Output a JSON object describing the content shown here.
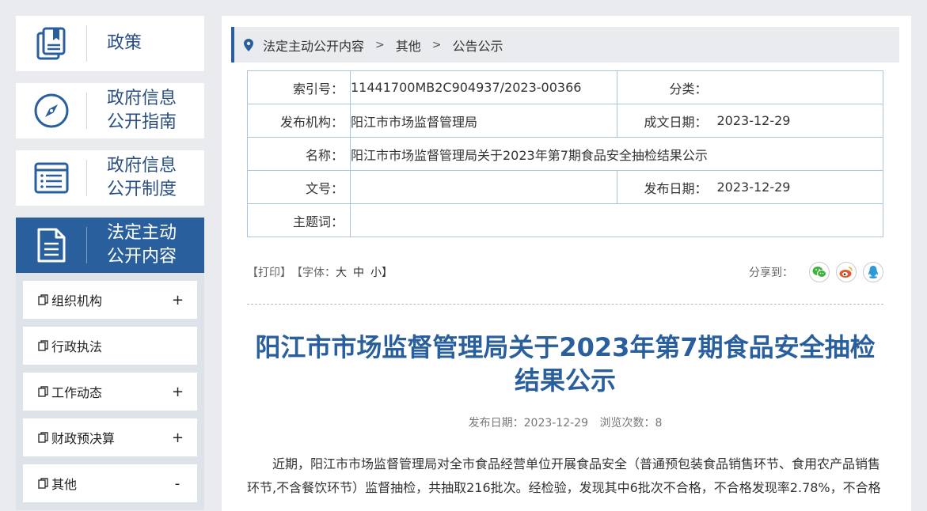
{
  "sidebar": {
    "blocks": [
      {
        "label": "政策",
        "icon": "book-icon"
      },
      {
        "label": "政府信息\n公开指南",
        "icon": "compass-icon"
      },
      {
        "label": "政府信息\n公开制度",
        "icon": "list-icon"
      },
      {
        "label": "法定主动\n公开内容",
        "icon": "document-icon",
        "active": true
      }
    ],
    "submenu": [
      {
        "label": "组织机构",
        "toggle": "+"
      },
      {
        "label": "行政执法",
        "toggle": ""
      },
      {
        "label": "工作动态",
        "toggle": "+"
      },
      {
        "label": "财政预决算",
        "toggle": "+"
      },
      {
        "label": "其他",
        "toggle": "-"
      }
    ]
  },
  "breadcrumb": {
    "items": [
      "法定主动公开内容",
      "其他",
      "公告公示"
    ],
    "separator": ">"
  },
  "meta": {
    "index_label": "索引号：",
    "index_value": "11441700MB2C904937/2023-00366",
    "category_label": "分类：",
    "category_value": "",
    "publisher_label": "发布机构：",
    "publisher_value": "阳江市市场监督管理局",
    "created_label": "成文日期：",
    "created_value": "2023-12-29",
    "name_label": "名称：",
    "name_value": "阳江市市场监督管理局关于2023年第7期食品安全抽检结果公示",
    "docno_label": "文号：",
    "docno_value": "",
    "published_label": "发布日期：",
    "published_value": "2023-12-29",
    "keywords_label": "主题词：",
    "keywords_value": ""
  },
  "tools": {
    "print": "【打印】",
    "font_prefix": "【字体：",
    "font_large": "大",
    "font_medium": "中",
    "font_small": "小】",
    "share_label": "分享到："
  },
  "article": {
    "title": "阳江市市场监督管理局关于2023年第7期食品安全抽检结果公示",
    "date_text": "发布日期：2023-12-29",
    "views_text": "浏览次数：8",
    "body": "近期，阳江市市场监督管理局对全市食品经营单位开展食品安全（普通预包装食品销售环节、食用农产品销售环节,不含餐饮环节）监督抽检，共抽取216批次。经检验，发现其中6批次不合格，不合格发现率2.78%，不合格"
  },
  "colors": {
    "accent": "#2a5f9e",
    "sidebar_text": "#2a4f80",
    "table_border": "#a9c4df",
    "wechat": "#3fb13d",
    "weibo": "#e6582c",
    "qq": "#2d9ad8"
  }
}
